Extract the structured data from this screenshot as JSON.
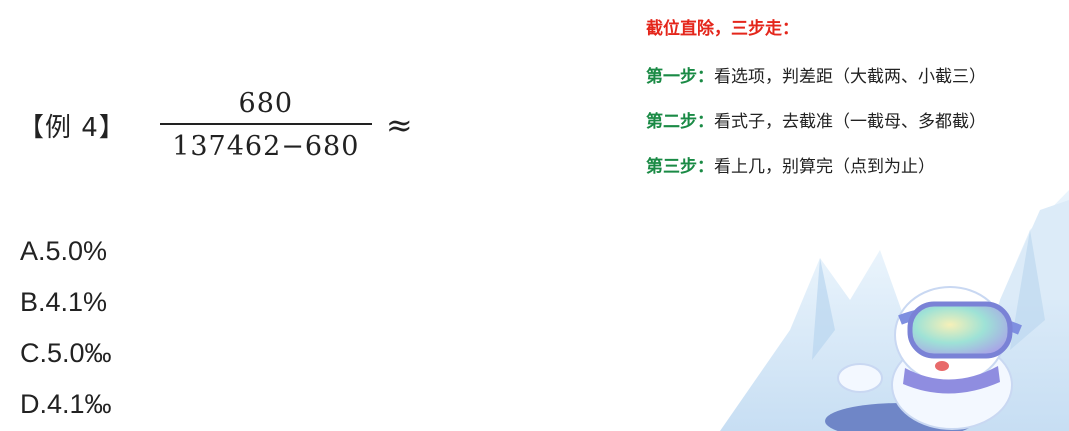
{
  "example": {
    "label": "【例 4】",
    "numerator": "680",
    "denominator": "137462−680",
    "approx": "≈"
  },
  "options": [
    {
      "text": "A.5.0%"
    },
    {
      "text": "B.4.1%"
    },
    {
      "text": "C.5.0‰"
    },
    {
      "text": "D.4.1‰"
    }
  ],
  "tips": {
    "title": "截位直除，三步走：",
    "steps": [
      {
        "label": "第一步：",
        "text": "看选项，判差距（大截两、小截三）"
      },
      {
        "label": "第二步：",
        "text": "看式子，去截准（一截母、多都截）"
      },
      {
        "label": "第三步：",
        "text": "看上几，别算完（点到为止）"
      }
    ]
  },
  "colors": {
    "title_red": "#e4261b",
    "step_green": "#1a8a45",
    "ice_blue": "#cfe4f7"
  }
}
